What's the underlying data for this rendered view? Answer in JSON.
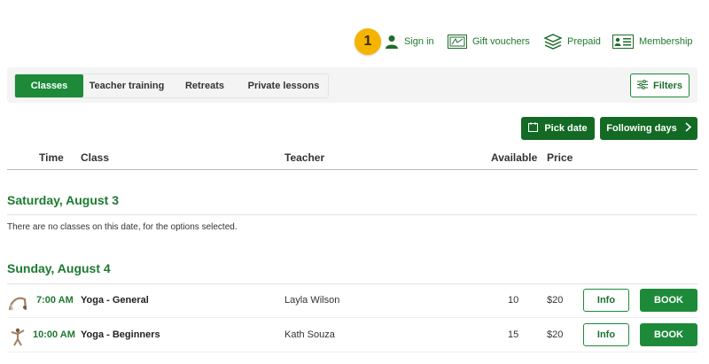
{
  "topnav": {
    "badge": "1",
    "sign_in": "Sign in",
    "gift_vouchers": "Gift vouchers",
    "prepaid": "Prepaid",
    "membership": "Membership"
  },
  "tabs": [
    {
      "label": "Classes",
      "active": true
    },
    {
      "label": "Teacher training",
      "active": false
    },
    {
      "label": "Retreats",
      "active": false
    },
    {
      "label": "Private lessons",
      "active": false
    }
  ],
  "filters_label": "Filters",
  "pick_date_label": "Pick date",
  "following_days_label": "Following days",
  "table": {
    "headers": {
      "time": "Time",
      "class": "Class",
      "teacher": "Teacher",
      "available": "Available",
      "price": "Price"
    }
  },
  "days": [
    {
      "heading": "Saturday, August 3",
      "empty_message": "There are no classes on this date, for the options selected."
    },
    {
      "heading": "Sunday, August 4"
    }
  ],
  "classes": [
    {
      "time": "7:00 AM",
      "name": "Yoga - General",
      "teacher": "Layla Wilson",
      "available": "10",
      "price": "$20",
      "info": "Info",
      "book": "BOOK"
    },
    {
      "time": "10:00 AM",
      "name": "Yoga - Beginners",
      "teacher": "Kath Souza",
      "available": "15",
      "price": "$20",
      "info": "Info",
      "book": "BOOK"
    }
  ],
  "colors": {
    "brand_green": "#1d8a3a",
    "dark_green": "#136a24",
    "badge_yellow": "#f5b400"
  }
}
